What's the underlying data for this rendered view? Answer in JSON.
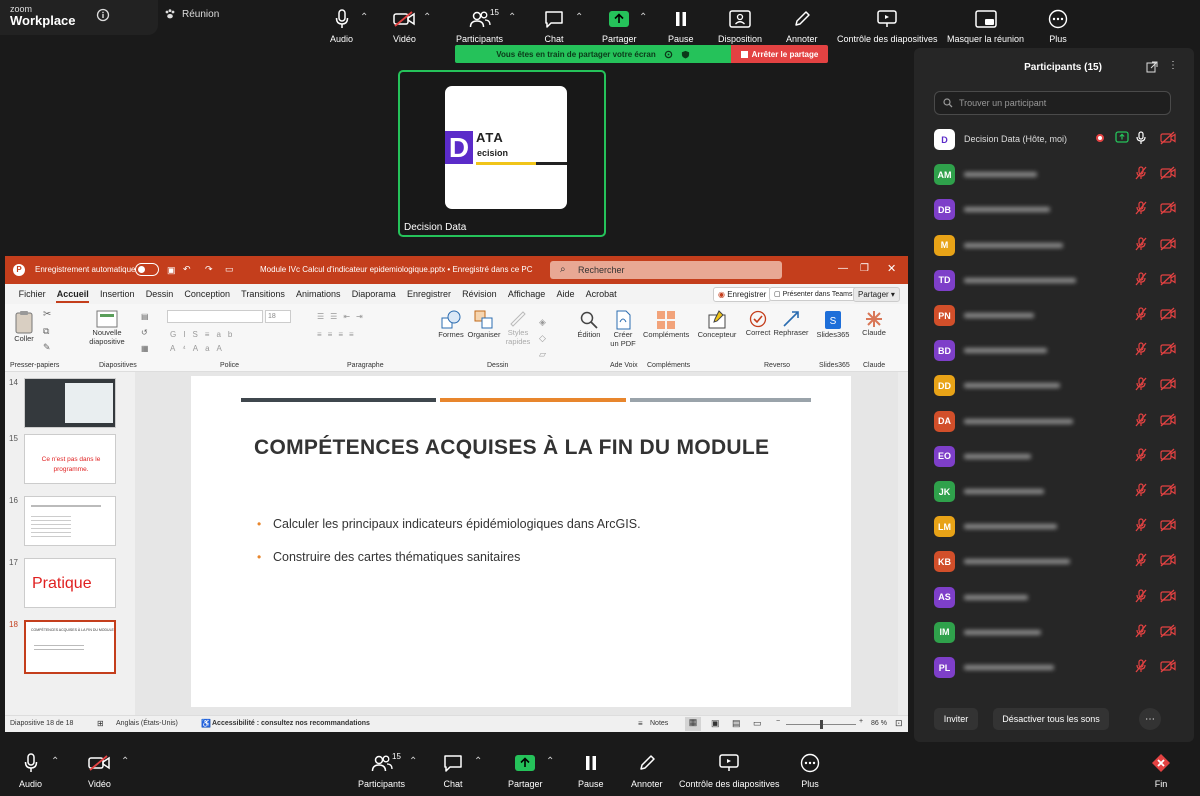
{
  "app": {
    "brand_line1": "zoom",
    "brand_line2": "Workplace",
    "meeting_label": "Réunion"
  },
  "toolbar_top": {
    "audio": "Audio",
    "video": "Vidéo",
    "participants": "Participants",
    "participants_count": "15",
    "chat": "Chat",
    "share": "Partager",
    "pause": "Pause",
    "layout": "Disposition",
    "annotate": "Annoter",
    "slide_control": "Contrôle des diapositives",
    "hide": "Masquer la réunion",
    "more": "Plus"
  },
  "share_banner": {
    "text": "Vous êtes en train de partager votre écran",
    "stop": "Arrêter le partage"
  },
  "self_tile": {
    "name": "Decision Data",
    "logo_text_1": "ATA",
    "logo_text_2": "ecision",
    "logo_letter": "D"
  },
  "ppt": {
    "autosave": "Enregistrement automatique",
    "filename": "Module IVc Calcul d'indicateur epidemiologique.pptx • Enregistré dans ce PC",
    "search": "Rechercher",
    "menu": [
      "Fichier",
      "Accueil",
      "Insertion",
      "Dessin",
      "Conception",
      "Transitions",
      "Animations",
      "Diaporama",
      "Enregistrer",
      "Révision",
      "Affichage",
      "Aide",
      "Acrobat"
    ],
    "menu_right": {
      "record": "Enregistrer",
      "present_teams": "Présenter dans Teams",
      "share": "Partager"
    },
    "ribbon": {
      "paste": "Coller",
      "new_slide_1": "Nouvelle",
      "new_slide_2": "diapositive",
      "font_size": "18",
      "shapes": "Formes",
      "arrange": "Organiser",
      "styles_1": "Styles",
      "styles_2": "rapides",
      "edit": "Édition",
      "pdf_1": "Créer",
      "pdf_2": "un PDF",
      "addins": "Compléments",
      "designer": "Concepteur",
      "correct": "Correct",
      "rephrase": "Rephraser",
      "slides365": "Slides365",
      "claude": "Claude"
    },
    "groups": {
      "clipboard": "Presser-papiers",
      "slides": "Diapositives",
      "font": "Police",
      "paragraph": "Paragraphe",
      "drawing": "Dessin",
      "voice": "Ade Voix",
      "addins": "Compléments",
      "reverso": "Reverso",
      "slides365": "Slides365",
      "claude": "Claude"
    },
    "thumbs": [
      {
        "num": "14",
        "text": ""
      },
      {
        "num": "15",
        "text": "Ce n'est pas dans le programme."
      },
      {
        "num": "16",
        "text": ""
      },
      {
        "num": "17",
        "text": "Pratique"
      },
      {
        "num": "18",
        "text": "COMPÉTENCES ACQUISES À LA FIN DU MODULE"
      }
    ],
    "slide": {
      "title": "COMPÉTENCES ACQUISES À LA FIN DU MODULE",
      "bullets": [
        "Calculer les principaux indicateurs épidémiologiques dans ArcGIS.",
        "Construire des cartes thématiques sanitaires"
      ],
      "bar_colors": [
        "#3f474d",
        "#e8862d",
        "#9aa3aa"
      ]
    },
    "status": {
      "slide": "Diapositive 18 de 18",
      "lang": "Anglais (États-Unis)",
      "access": "Accessibilité : consultez nos recommandations",
      "notes": "Notes",
      "zoom": "86 %"
    }
  },
  "panel": {
    "title": "Participants (15)",
    "search_placeholder": "Trouver un participant",
    "participants": [
      {
        "initials": "D",
        "name": "Decision Data (Hôte, moi)",
        "color": "#ffffff",
        "text": "#5b2bc9"
      },
      {
        "initials": "AM",
        "name": "",
        "color": "#2fa14b",
        "text": "#ffffff"
      },
      {
        "initials": "DB",
        "name": "",
        "color": "#7e3fc9",
        "text": "#ffffff"
      },
      {
        "initials": "M",
        "name": "",
        "color": "#e8a317",
        "text": "#ffffff"
      },
      {
        "initials": "TD",
        "name": "",
        "color": "#7e3fc9",
        "text": "#ffffff"
      },
      {
        "initials": "PN",
        "name": "",
        "color": "#d24f2a",
        "text": "#ffffff"
      },
      {
        "initials": "BD",
        "name": "",
        "color": "#7e3fc9",
        "text": "#ffffff"
      },
      {
        "initials": "DD",
        "name": "",
        "color": "#e8a317",
        "text": "#ffffff"
      },
      {
        "initials": "DA",
        "name": "",
        "color": "#d24f2a",
        "text": "#ffffff"
      },
      {
        "initials": "EO",
        "name": "",
        "color": "#7e3fc9",
        "text": "#ffffff"
      },
      {
        "initials": "JK",
        "name": "",
        "color": "#2fa14b",
        "text": "#ffffff"
      },
      {
        "initials": "LM",
        "name": "",
        "color": "#e8a317",
        "text": "#ffffff"
      },
      {
        "initials": "KB",
        "name": "",
        "color": "#d24f2a",
        "text": "#ffffff"
      },
      {
        "initials": "AS",
        "name": "",
        "color": "#7e3fc9",
        "text": "#ffffff"
      },
      {
        "initials": "IM",
        "name": "",
        "color": "#2fa14b",
        "text": "#ffffff"
      },
      {
        "initials": "PL",
        "name": "",
        "color": "#7e3fc9",
        "text": "#ffffff"
      }
    ],
    "invite": "Inviter",
    "mute_all": "Désactiver tous les sons"
  },
  "toolbar_bottom": {
    "audio": "Audio",
    "video": "Vidéo",
    "participants": "Participants",
    "participants_count": "15",
    "chat": "Chat",
    "share": "Partager",
    "pause": "Pause",
    "annotate": "Annoter",
    "slide_control": "Contrôle des diapositives",
    "more": "Plus",
    "end": "Fin"
  },
  "colors": {
    "share_green": "#25c25a",
    "stop_red": "#e34242",
    "ppt_red": "#c43e1c",
    "brand_purple": "#5b2bc9"
  }
}
